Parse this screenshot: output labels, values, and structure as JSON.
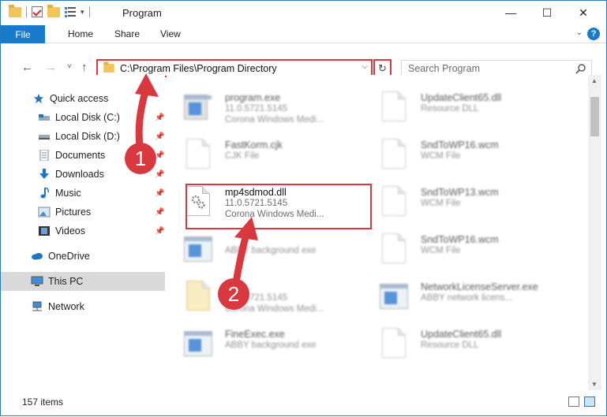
{
  "window": {
    "title": "Program",
    "controls": [
      "—",
      "☐",
      "✕"
    ]
  },
  "ribbon": {
    "file_tab": "File",
    "tabs": [
      "Home",
      "Share",
      "View"
    ],
    "help": "?"
  },
  "navbar": {
    "back": "←",
    "forward": "→",
    "recent": "˅",
    "up": "↑",
    "address": "C:\\Program Files\\Program Directory",
    "dropdown": "⌵",
    "refresh": "↻",
    "search_placeholder": "Search Program"
  },
  "sidebar": {
    "items": [
      {
        "label": "Quick access",
        "icon": "star-icon"
      },
      {
        "label": "Local Disk (C:)",
        "icon": "drive-icon",
        "pinned": true
      },
      {
        "label": "Local Disk (D:)",
        "icon": "drive-icon",
        "pinned": true
      },
      {
        "label": "Documents",
        "icon": "documents-icon",
        "pinned": true
      },
      {
        "label": "Downloads",
        "icon": "downloads-icon",
        "pinned": true
      },
      {
        "label": "Music",
        "icon": "music-icon",
        "pinned": true
      },
      {
        "label": "Pictures",
        "icon": "pictures-icon",
        "pinned": true
      },
      {
        "label": "Videos",
        "icon": "videos-icon",
        "pinned": true
      },
      {
        "label": "OneDrive",
        "icon": "onedrive-icon"
      },
      {
        "label": "This PC",
        "icon": "computer-icon",
        "selected": true
      },
      {
        "label": "Network",
        "icon": "network-icon"
      }
    ]
  },
  "files": [
    {
      "name": "program.exe",
      "line1": "11.0.5721.5145",
      "line2": "Corona Windows Medi...",
      "icon": "exe-icon"
    },
    {
      "name": "UpdateClient65.dll",
      "line1": "Resource DLL",
      "line2": "",
      "icon": "dll-icon"
    },
    {
      "name": "FastKorm.cjk",
      "line1": "CJK File",
      "line2": "",
      "icon": "file-icon"
    },
    {
      "name": "SndToWP16.wcm",
      "line1": "WCM File",
      "line2": "",
      "icon": "file-icon"
    },
    {
      "name": "mp4sdmod.dll",
      "line1": "11.0.5721.5145",
      "line2": "Corona Windows Medi...",
      "icon": "dll-gear-icon"
    },
    {
      "name": "SndToWP13.wcm",
      "line1": "WCM File",
      "line2": "",
      "icon": "file-icon"
    },
    {
      "name": "",
      "line1": "ABBY background exe",
      "line2": "",
      "icon": "exe-icon"
    },
    {
      "name": "SndToWP16.wcm",
      "line1": "WCM File",
      "line2": "",
      "icon": "file-icon"
    },
    {
      "name": "",
      "line1": "11.0.5721.5145",
      "line2": "Corona Windows Medi...",
      "icon": "folder-icon"
    },
    {
      "name": "NetworkLicenseServer.exe",
      "line1": "ABBY network licens...",
      "line2": "",
      "icon": "exe-icon"
    },
    {
      "name": "FineExec.exe",
      "line1": "ABBY background exe",
      "line2": "",
      "icon": "exe-icon"
    },
    {
      "name": "UpdateClient65.dll",
      "line1": "Resource DLL",
      "line2": "",
      "icon": "dll-icon"
    }
  ],
  "annotations": {
    "step1": "1",
    "step2": "2",
    "color": "#d9393e"
  },
  "status": {
    "count": "157 items"
  }
}
